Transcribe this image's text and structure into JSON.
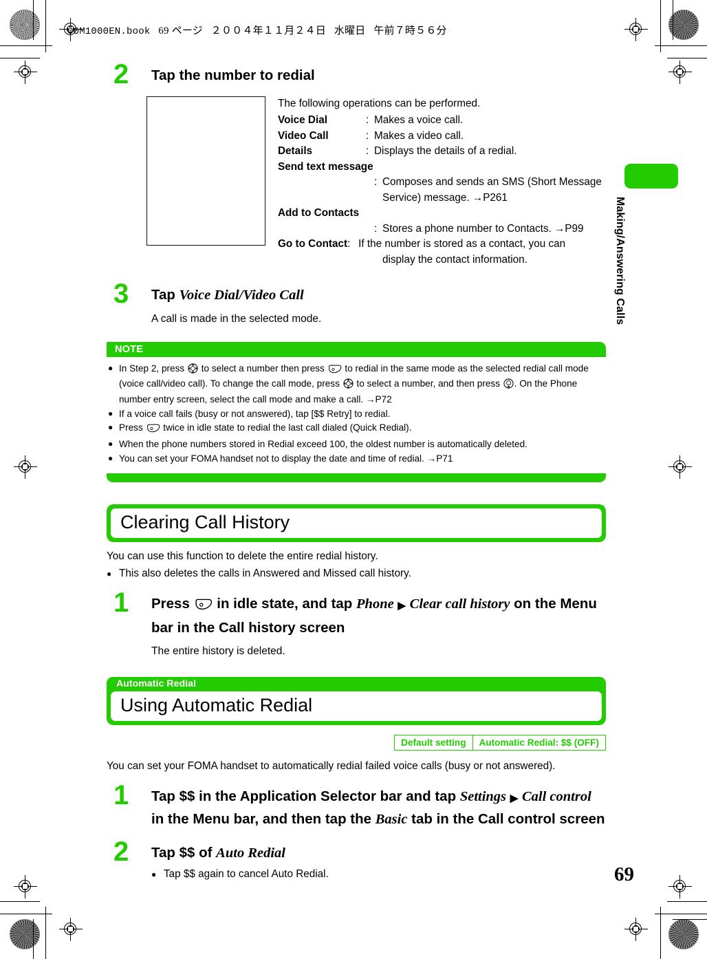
{
  "header": {
    "file": "00M1000EN.book",
    "page_label": "69 ページ",
    "date": "２００４年１１月２４日",
    "weekday": "水曜日",
    "time": "午前７時５６分"
  },
  "sidebar": {
    "chapter_label": "Making/Answering Calls"
  },
  "page_number": "69",
  "colors": {
    "green": "#22cc00",
    "text": "#000000"
  },
  "steps": {
    "step2": {
      "number": "2",
      "title": "Tap the number to redial",
      "figure_caption": "",
      "definitions": {
        "intro": "The following operations can be performed.",
        "items": [
          {
            "term": "Voice Dial",
            "colon": ":",
            "desc": "Makes a voice call."
          },
          {
            "term": "Video Call",
            "colon": ":",
            "desc": "Makes a video call."
          },
          {
            "term": "Details",
            "colon": ":",
            "desc": "Displays the details of a redial."
          },
          {
            "term": "Send text message",
            "colon": "",
            "desc": ""
          },
          {
            "term": "",
            "colon": ":",
            "desc": "Composes and sends an SMS (Short Message",
            "desc2": "Service) message. →P261"
          },
          {
            "term": "Add to Contacts",
            "colon": "",
            "desc": ""
          },
          {
            "term": "",
            "colon": ":",
            "desc": "Stores a phone number to Contacts. →P99"
          },
          {
            "term": "Go to Contact",
            "colon": ":",
            "desc": "If the number is stored as a contact, you can",
            "desc2": "display the contact information."
          }
        ]
      }
    },
    "step3": {
      "number": "3",
      "title_prefix": "Tap ",
      "title_italic": "Voice Dial/Video Call",
      "body": "A call is made in the selected mode."
    }
  },
  "note": {
    "heading": "NOTE",
    "items": [
      "In Step 2, press [dpad] to select a number then press [callkey] to redial in the same mode as the selected redial call mode (voice call/video call). To change the call mode, press [dpad] to select a number, and then press [dpad-down]. On the Phone number entry screen, select the call mode and make a call. →P72",
      "If a voice call fails (busy or not answered), tap [$$ Retry] to redial.",
      "Press [callkey] twice in idle state to redial the last call dialed (Quick Redial).",
      "When the phone numbers stored in Redial exceed 100, the oldest number is automatically deleted.",
      "You can set your FOMA handset not to display the date and time of redial. →P71"
    ],
    "item_parts": {
      "i1_a": "In Step 2, press ",
      "i1_b": " to select a number then press ",
      "i1_c": " to redial in the same mode as the selected redial call mode (voice call/video call). To change the call mode, press ",
      "i1_d": " to select a number, and then press ",
      "i1_e": ". On the Phone number entry screen, select the call mode and make a call. →P72",
      "i2": "If a voice call fails (busy or not answered), tap [$$ Retry] to redial.",
      "i3_a": "Press ",
      "i3_b": " twice in idle state to redial the last call dialed (Quick Redial).",
      "i4": "When the phone numbers stored in Redial exceed 100, the oldest number is automatically deleted.",
      "i5": "You can set your FOMA handset not to display the date and time of redial. →P71"
    }
  },
  "section_clearing": {
    "title": "Clearing Call History",
    "intro": "You can use this function to delete the entire redial history.",
    "bullet": "This also deletes the calls in Answered and Missed call history.",
    "step": {
      "number": "1",
      "t1": "Press ",
      "t2": " in idle state, and tap ",
      "t3_italic": "Phone",
      "t4_arrow": "▶",
      "t5_italic": "Clear call history",
      "t6": " on the Menu bar in the Call history screen",
      "body": "The entire history is deleted."
    }
  },
  "section_auto_redial": {
    "tag": "Automatic Redial",
    "title": "Using Automatic Redial",
    "default_setting": {
      "label": "Default setting",
      "value": "Automatic Redial:  $$ (OFF)"
    },
    "intro": "You can set your FOMA handset to automatically redial failed voice calls (busy or not answered).",
    "step1": {
      "number": "1",
      "t1": "Tap $$ in the Application Selector bar and tap ",
      "t2_italic": "Settings",
      "t3_arrow": "▶",
      "t4_italic": "Call control",
      "t5": " in the Menu bar, and then tap the ",
      "t6_italic": "Basic",
      "t7": " tab in the Call control screen"
    },
    "step2": {
      "number": "2",
      "t1": "Tap $$ of ",
      "t2_italic": "Auto Redial",
      "bullet_a": "Tap $$ again to cancel ",
      "bullet_b": "Auto Redial."
    }
  },
  "icons": {
    "dpad": "dpad-key-icon",
    "callkey": "call-send-key-icon",
    "dpad_down": "dpad-down-key-icon"
  }
}
